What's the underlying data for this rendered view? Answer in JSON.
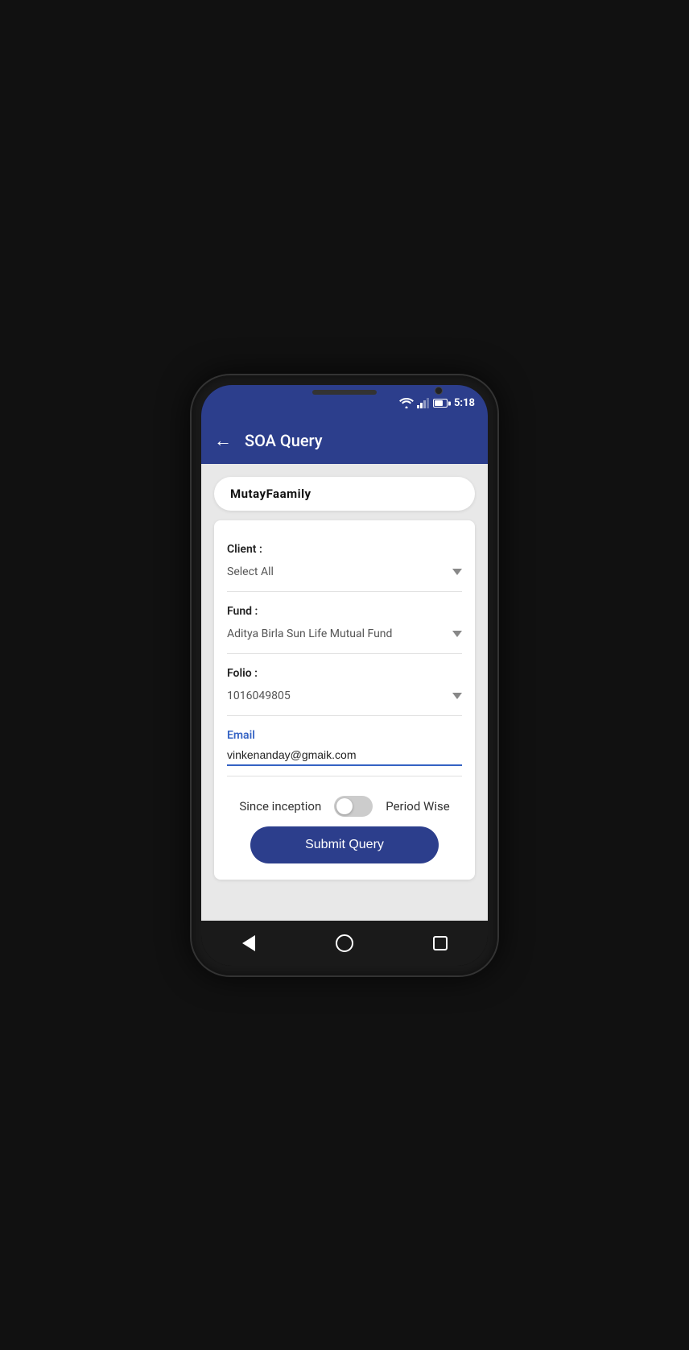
{
  "statusBar": {
    "time": "5:18"
  },
  "appBar": {
    "title": "SOA Query",
    "backLabel": "←"
  },
  "searchBar": {
    "value": "MutayFaamily"
  },
  "form": {
    "clientLabel": "Client :",
    "clientValue": "Select All",
    "fundLabel": "Fund :",
    "fundValue": "Aditya Birla Sun Life Mutual Fund",
    "folioLabel": "Folio :",
    "folioValue": "1016049805",
    "emailLabel": "Email",
    "emailValue": "vinkenanday@gmaik.com",
    "sinceInceptionLabel": "Since inception",
    "periodWiseLabel": "Period Wise",
    "submitLabel": "Submit Query"
  },
  "bottomNav": {
    "back": "◀",
    "home": "●",
    "recent": "■"
  }
}
